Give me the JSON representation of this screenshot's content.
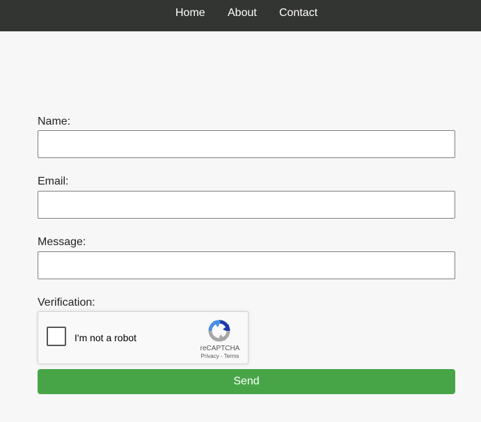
{
  "nav": {
    "items": [
      {
        "label": "Home"
      },
      {
        "label": "About"
      },
      {
        "label": "Contact"
      }
    ]
  },
  "form": {
    "name_label": "Name:",
    "name_value": "",
    "email_label": "Email:",
    "email_value": "",
    "message_label": "Message:",
    "message_value": "",
    "verification_label": "Verification:",
    "send_label": "Send"
  },
  "recaptcha": {
    "checkbox_label": "I'm not a robot",
    "checked": false,
    "brand": "reCAPTCHA",
    "privacy_link": "Privacy",
    "separator": "-",
    "terms_link": "Terms",
    "icon": "recaptcha-logo-icon"
  },
  "colors": {
    "navbar_bg": "#333532",
    "page_bg": "#f7f7f7",
    "send_button_bg": "#47a547"
  }
}
